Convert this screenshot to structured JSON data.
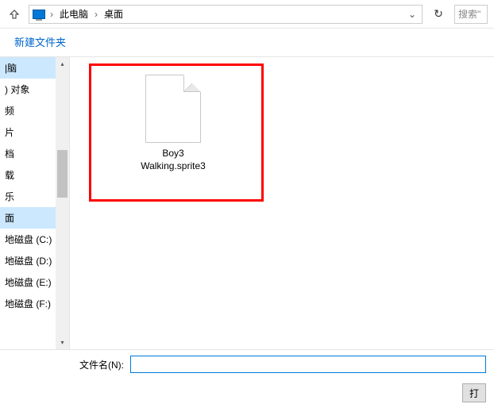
{
  "address": {
    "crumb1": "此电脑",
    "crumb2": "桌面",
    "sep": "›"
  },
  "search": {
    "placeholder": "搜索\""
  },
  "toolbar": {
    "new_folder": "新建文件夹"
  },
  "sidebar": {
    "items": [
      {
        "label": "|脑",
        "selected": true
      },
      {
        "label": ") 对象",
        "selected": false
      },
      {
        "label": "频",
        "selected": false
      },
      {
        "label": "片",
        "selected": false
      },
      {
        "label": "档",
        "selected": false
      },
      {
        "label": "载",
        "selected": false
      },
      {
        "label": "乐",
        "selected": false
      },
      {
        "label": "面",
        "selected": true
      },
      {
        "label": " 地磁盘 (C:)",
        "selected": false
      },
      {
        "label": " 地磁盘 (D:)",
        "selected": false
      },
      {
        "label": " 地磁盘 (E:)",
        "selected": false
      },
      {
        "label": " 地磁盘 (F:)",
        "selected": false
      }
    ]
  },
  "file": {
    "name_line1": "Boy3",
    "name_line2": "Walking.sprite3"
  },
  "filename": {
    "label": "文件名(N):",
    "value": ""
  },
  "buttons": {
    "open": "打"
  }
}
